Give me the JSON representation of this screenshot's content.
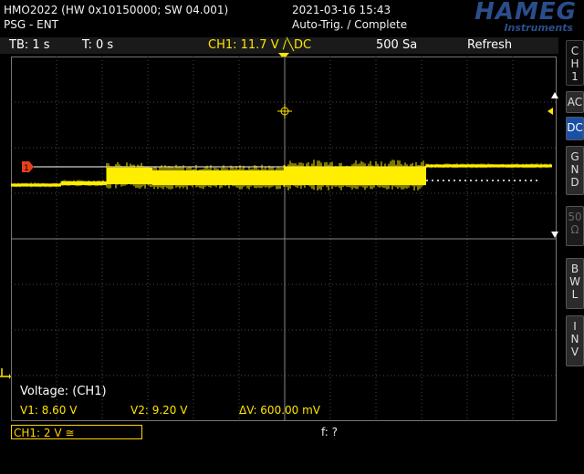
{
  "header": {
    "model_line": "HMO2022 (HW 0x10150000; SW 04.001)",
    "mode_line": "PSG - ENT",
    "datetime": "2021-03-16 15:43",
    "trigger_status": "Auto-Trig. / Complete",
    "logo_main": "HAMEG",
    "logo_sub": "Instruments"
  },
  "statusbar": {
    "timebase": "TB: 1 s",
    "trigger_time": "T: 0 s",
    "channel_info": "CH1: 11.7 V ∕╲DC",
    "sample_rate": "500 Sa",
    "acq_mode": "Refresh"
  },
  "side_menu": {
    "ch_label": [
      "C",
      "H",
      "1"
    ],
    "ac": "AC",
    "dc": "DC",
    "gnd": [
      "G",
      "N",
      "D"
    ],
    "fifty_ohm": [
      "50",
      "Ω"
    ],
    "bwl": [
      "B",
      "W",
      "L"
    ],
    "inv": [
      "I",
      "N",
      "V"
    ]
  },
  "cursor": {
    "title": "Voltage: (CH1)",
    "v1": "V1: 8.60 V",
    "v2": "V2: 9.20 V",
    "delta": "ΔV: 600.00 mV"
  },
  "bottom": {
    "channel_scale": "CH1: 2 V ≅",
    "frequency": "f: ?"
  },
  "colors": {
    "trace": "#ffee00",
    "grid": "#5a5a5a",
    "marker": "#e8401c",
    "accent": "#1a4fa8"
  }
}
